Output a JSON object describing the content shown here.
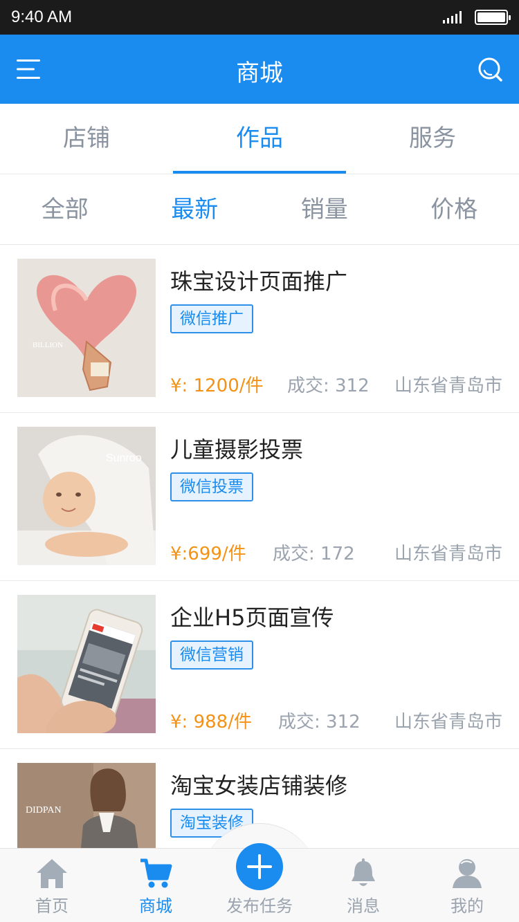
{
  "status_bar": {
    "time": "9:40 AM"
  },
  "header": {
    "title": "商城"
  },
  "tabs": [
    {
      "label": "店铺"
    },
    {
      "label": "作品"
    },
    {
      "label": "服务"
    }
  ],
  "filters": [
    {
      "label": "全部"
    },
    {
      "label": "最新"
    },
    {
      "label": "销量"
    },
    {
      "label": "价格"
    }
  ],
  "items": [
    {
      "title": "珠宝设计页面推广",
      "tag": "微信推广",
      "price": "¥: 1200/件",
      "deals": "成交: 312",
      "location": "山东省青岛市",
      "image_text": "BILLION"
    },
    {
      "title": "儿童摄影投票",
      "tag": "微信投票",
      "price": "¥:699/件",
      "deals": "成交: 172",
      "location": "山东省青岛市",
      "image_text": "Sunroo"
    },
    {
      "title": "企业H5页面宣传",
      "tag": "微信营销",
      "price": "¥: 988/件",
      "deals": "成交: 312",
      "location": "山东省青岛市",
      "image_text": ""
    },
    {
      "title": "淘宝女装店铺装修",
      "tag": "淘宝装修",
      "price": "",
      "deals": "",
      "location": "",
      "image_text": "DIDPAN"
    }
  ],
  "bottom_nav": [
    {
      "label": "首页",
      "icon": "home-icon"
    },
    {
      "label": "商城",
      "icon": "cart-icon"
    },
    {
      "label": "发布任务",
      "icon": "plus-icon"
    },
    {
      "label": "消息",
      "icon": "bell-icon"
    },
    {
      "label": "我的",
      "icon": "profile-icon"
    }
  ],
  "colors": {
    "accent": "#1a8cf0",
    "price": "#f39215",
    "muted": "#9aa3ae"
  }
}
